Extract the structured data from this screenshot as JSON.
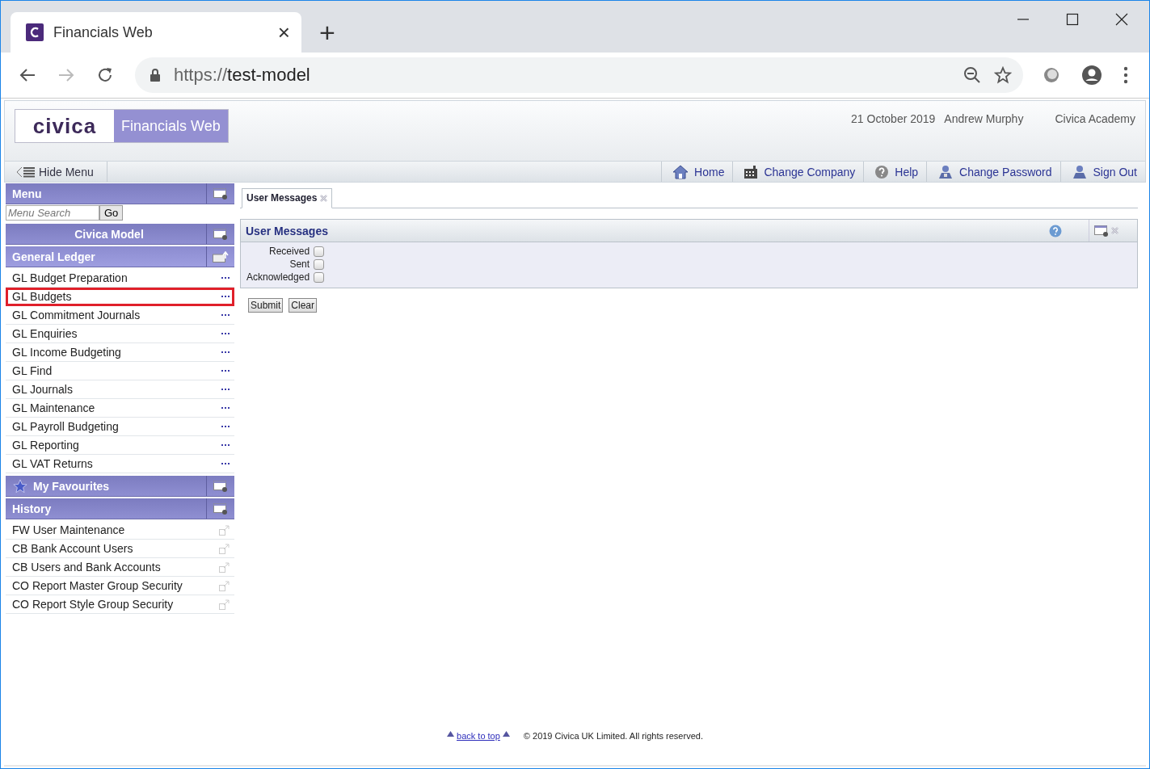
{
  "browser": {
    "tab_title": "Financials Web",
    "tab_close": "×",
    "new_tab": "+",
    "url_scheme": "https://",
    "url_host": "test-model"
  },
  "header": {
    "logo": "civica",
    "product": "Financials Web",
    "date": "21 October 2019",
    "user": "Andrew Murphy",
    "company": "Civica Academy"
  },
  "toolbar": {
    "hide_menu": "Hide Menu",
    "links": [
      {
        "kind": "home",
        "label": "Home"
      },
      {
        "kind": "company",
        "label": "Change Company"
      },
      {
        "kind": "help",
        "label": "Help"
      },
      {
        "kind": "password",
        "label": "Change Password"
      },
      {
        "kind": "signout",
        "label": "Sign Out"
      }
    ]
  },
  "sidebar": {
    "menu_title": "Menu",
    "search": {
      "placeholder": "Menu Search",
      "button": "Go"
    },
    "model": "Civica Model",
    "ledger": "General Ledger",
    "items": [
      {
        "label": "GL Budget Preparation",
        "highlighted": false
      },
      {
        "label": "GL Budgets",
        "highlighted": true
      },
      {
        "label": "GL Commitment Journals",
        "highlighted": false
      },
      {
        "label": "GL Enquiries",
        "highlighted": false
      },
      {
        "label": "GL Income Budgeting",
        "highlighted": false
      },
      {
        "label": "GL Find",
        "highlighted": false
      },
      {
        "label": "GL Journals",
        "highlighted": false
      },
      {
        "label": "GL Maintenance",
        "highlighted": false
      },
      {
        "label": "GL Payroll Budgeting",
        "highlighted": false
      },
      {
        "label": "GL Reporting",
        "highlighted": false
      },
      {
        "label": "GL VAT Returns",
        "highlighted": false
      }
    ],
    "favourites": "My Favourites",
    "history_title": "History",
    "history": [
      "FW User Maintenance",
      "CB Bank Account Users",
      "CB Users and Bank Accounts",
      "CO Report Master Group Security",
      "CO Report Style Group Security"
    ]
  },
  "tabs": [
    {
      "label": "User Messages",
      "selected": true
    }
  ],
  "panel": {
    "title": "User Messages",
    "filters": [
      {
        "label": "Received",
        "checked": false
      },
      {
        "label": "Sent",
        "checked": false
      },
      {
        "label": "Acknowledged",
        "checked": false
      }
    ],
    "buttons": [
      "Submit",
      "Clear"
    ]
  },
  "footer": {
    "back_to_top": "back to top",
    "copyright": "© 2019 Civica UK Limited. All rights reserved."
  }
}
